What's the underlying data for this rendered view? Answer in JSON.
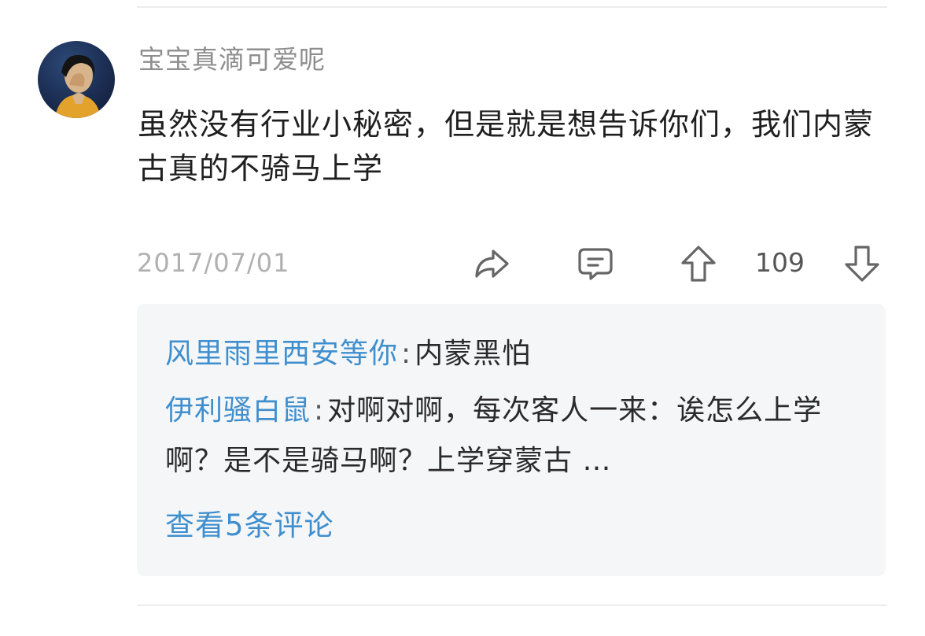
{
  "comment": {
    "username": "宝宝真滴可爱呢",
    "text": "虽然没有行业小秘密，但是就是想告诉你们，我们内蒙古真的不骑马上学",
    "date": "2017/07/01",
    "votes": "109"
  },
  "icons": {
    "share": "share-icon",
    "reply": "comment-bubble-icon",
    "upvote": "arrow-up-icon",
    "downvote": "arrow-down-icon"
  },
  "replies": [
    {
      "name": "风里雨里西安等你",
      "separator": ":",
      "text": "内蒙黑怕"
    },
    {
      "name": "伊利骚白鼠",
      "separator": ":",
      "text": "对啊对啊，每次客人一来：诶怎么上学啊？是不是骑马啊？上学穿蒙古 …"
    }
  ],
  "view_more": "查看5条评论",
  "colors": {
    "link": "#3f8fce",
    "username": "#8e8e8e",
    "date": "#b0b0b0",
    "reply_bg": "#f5f6f8"
  }
}
